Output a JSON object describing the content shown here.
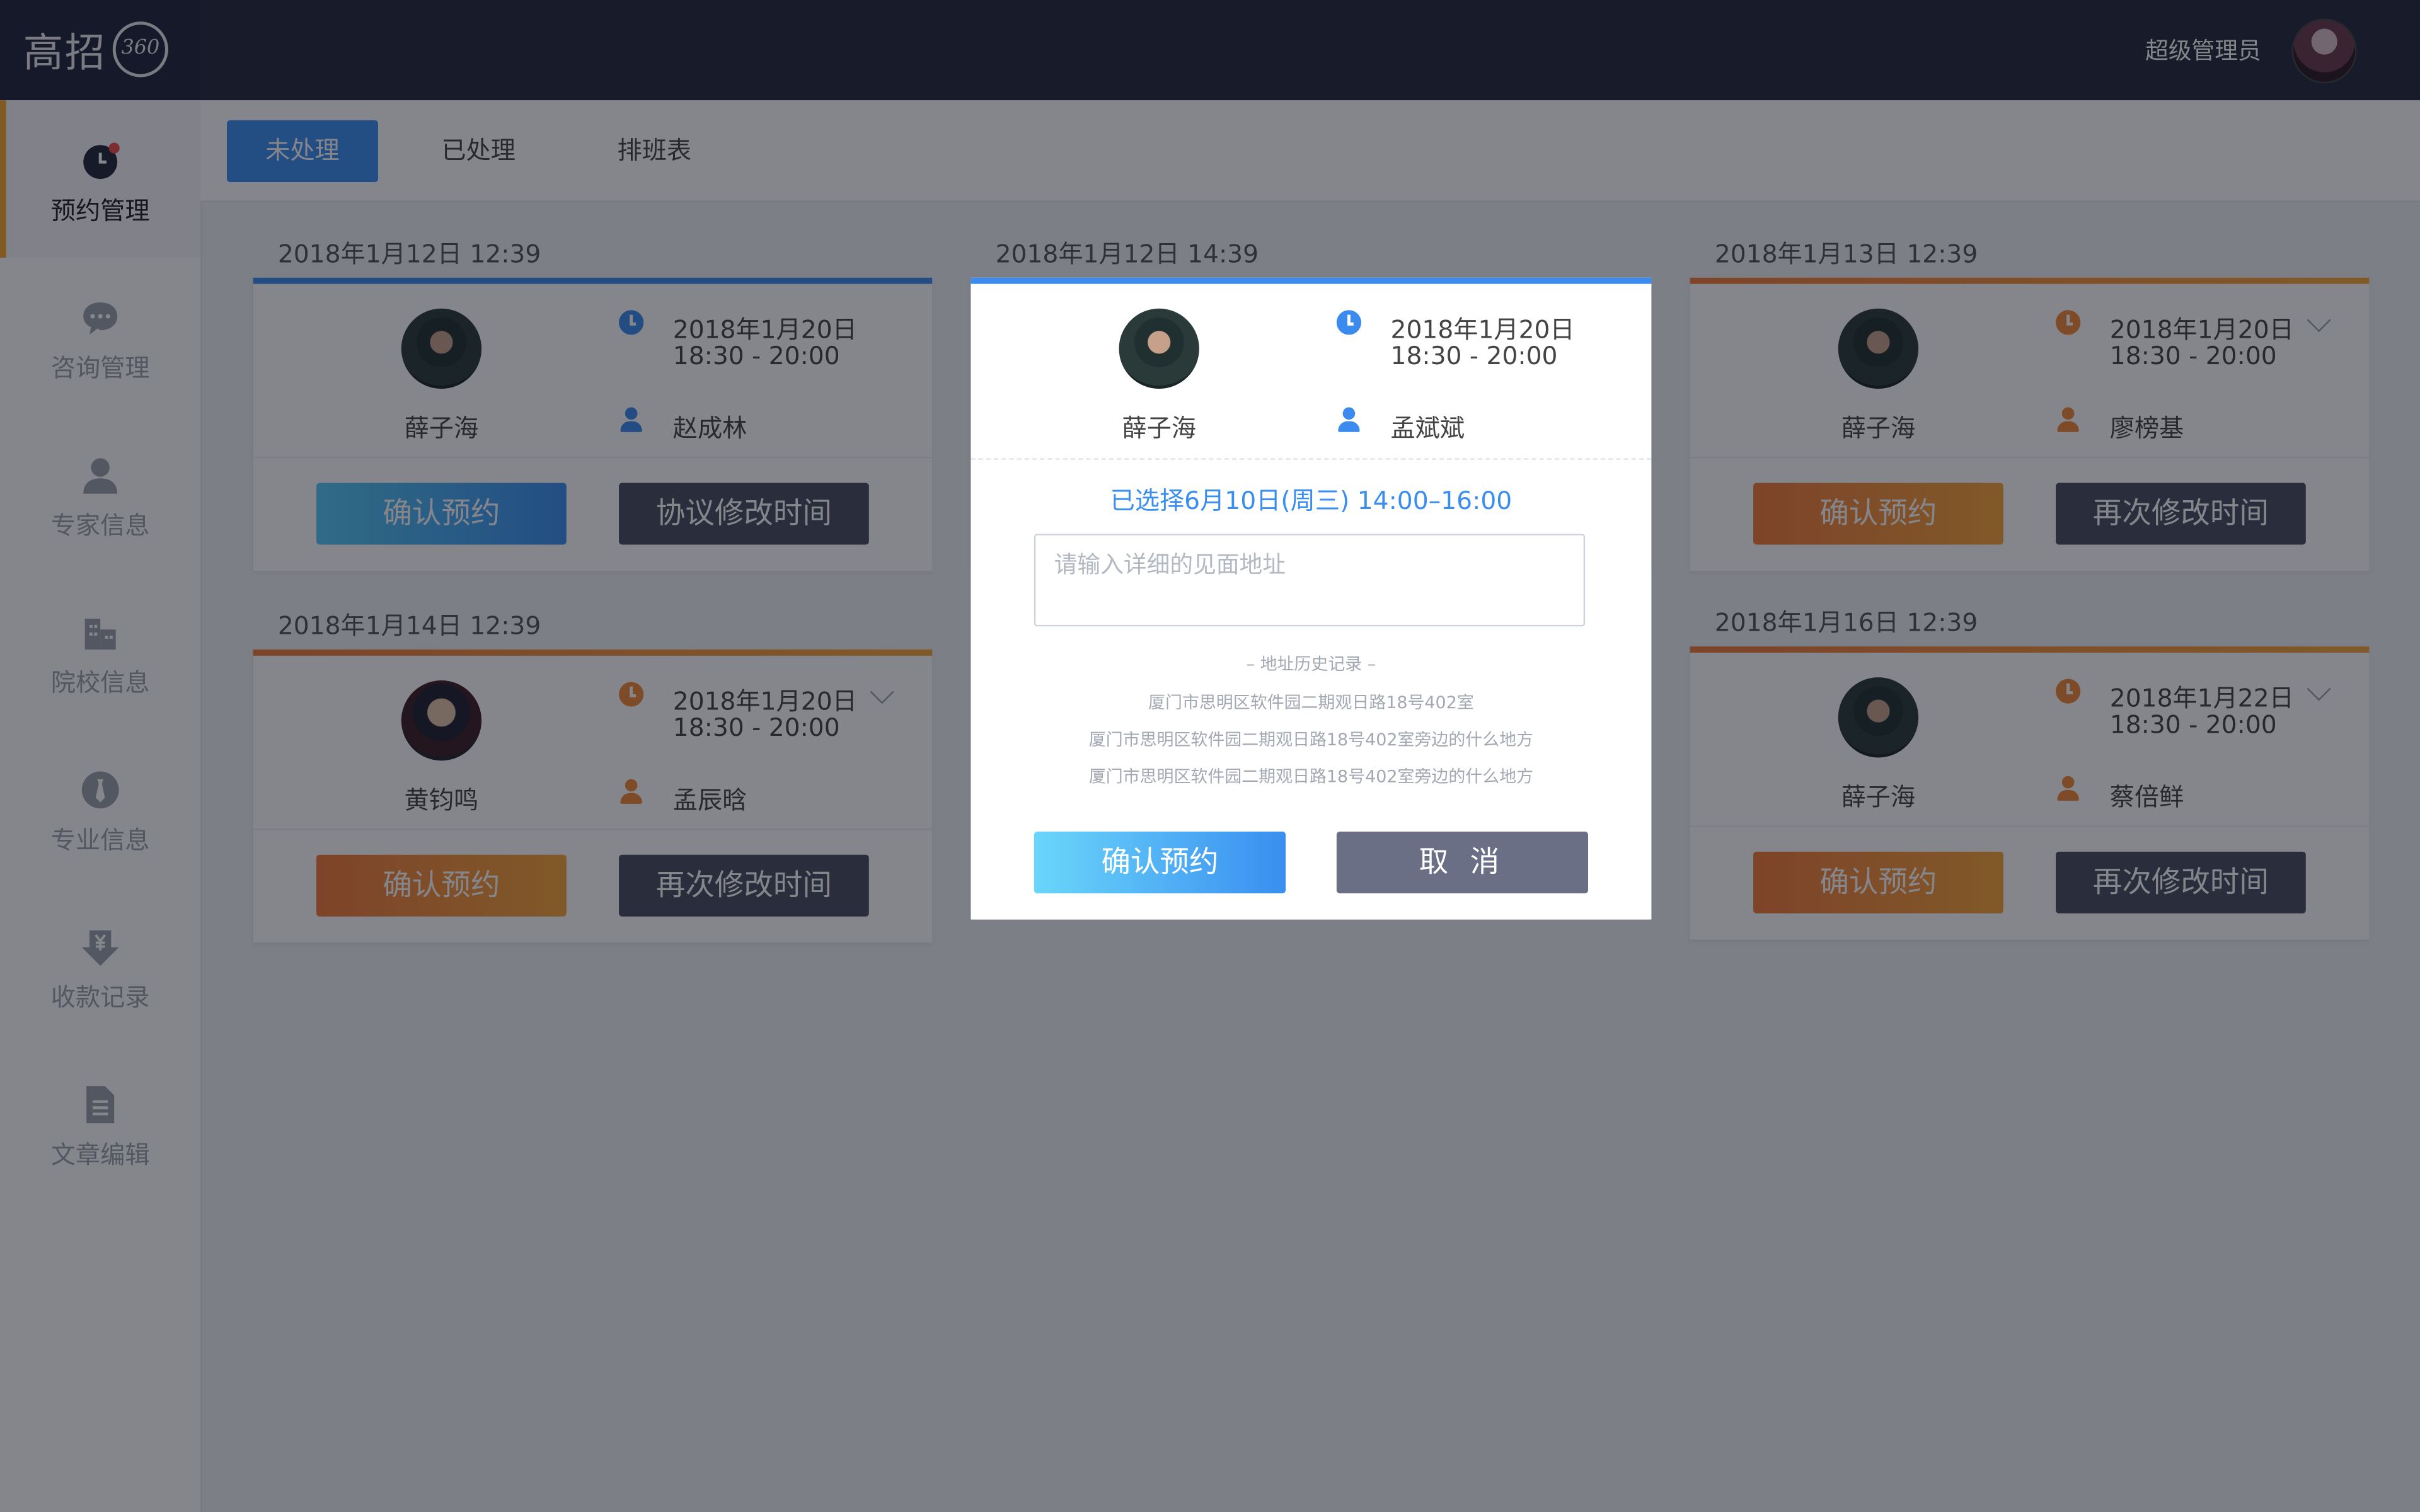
{
  "header": {
    "logo_text": "高招",
    "logo_badge": "360",
    "admin_name": "超级管理员"
  },
  "sidebar": {
    "items": [
      {
        "label": "预约管理",
        "icon": "clock-icon",
        "active": true
      },
      {
        "label": "咨询管理",
        "icon": "chat-bubble-icon"
      },
      {
        "label": "专家信息",
        "icon": "person-icon"
      },
      {
        "label": "院校信息",
        "icon": "building-icon"
      },
      {
        "label": "专业信息",
        "icon": "tie-icon"
      },
      {
        "label": "收款记录",
        "icon": "yen-download-icon"
      },
      {
        "label": "文章编辑",
        "icon": "document-icon"
      }
    ]
  },
  "tabs": [
    {
      "label": "未处理",
      "active": true
    },
    {
      "label": "已处理"
    },
    {
      "label": "排班表"
    }
  ],
  "cards": [
    {
      "created": "2018年1月12日  12:39",
      "expert": "薛子海",
      "date": "2018年1月20日",
      "time": "18:30 - 20:00",
      "client": "赵成林",
      "accent": "blue",
      "btn_left": "确认预约",
      "btn_right": "协议修改时间"
    },
    {
      "created": "2018年1月12日  14:39"
    },
    {
      "created": "2018年1月13日  12:39",
      "expert": "薛子海",
      "date": "2018年1月20日",
      "time": "18:30 - 20:00",
      "client": "廖榜基",
      "accent": "orange",
      "btn_left": "确认预约",
      "btn_right": "再次修改时间"
    },
    {
      "created": "2018年1月14日  12:39",
      "expert": "黄钧鸣",
      "date": "2018年1月20日",
      "time": "18:30 - 20:00",
      "client": "孟辰晗",
      "accent": "orange",
      "btn_left": "确认预约",
      "btn_right": "再次修改时间"
    },
    {
      "created": "2018年1月16日  12:39",
      "expert": "薛子海",
      "date": "2018年1月22日",
      "time": "18:30 - 20:00",
      "client": "蔡倍鲜",
      "accent": "orange",
      "btn_left": "确认预约",
      "btn_right": "再次修改时间"
    }
  ],
  "modal": {
    "expert": "薛子海",
    "date": "2018年1月20日",
    "time": "18:30 - 20:00",
    "client": "孟斌斌",
    "selected_text": "已选择6月10日(周三) 14:00–16:00",
    "address_placeholder": "请输入详细的见面地址",
    "address_value": "",
    "history_title": "– 地址历史记录 –",
    "history": [
      "厦门市思明区软件园二期观日路18号402室",
      "厦门市思明区软件园二期观日路18号402室旁边的什么地方",
      "厦门市思明区软件园二期观日路18号402室旁边的什么地方"
    ],
    "confirm_label": "确认预约",
    "cancel_label": "取 消"
  },
  "colors": {
    "primary": "#3a8ef0",
    "accent_orange": "#f0883a",
    "dark_button": "#474c60",
    "header_bg": "#252a3d"
  }
}
